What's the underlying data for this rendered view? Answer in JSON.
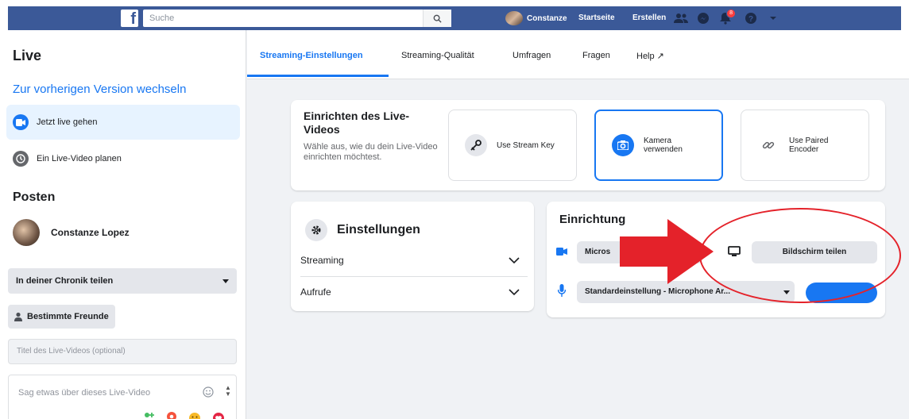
{
  "topbar": {
    "logo": "f",
    "search_placeholder": "Suche",
    "user_name": "Constanze",
    "home_label": "Startseite",
    "create_label": "Erstellen",
    "notifications_count": "8"
  },
  "sidebar": {
    "title": "Live",
    "switch_version": "Zur vorherigen Version wechseln",
    "items": [
      {
        "label": "Jetzt live gehen",
        "icon": "live-camera-icon"
      },
      {
        "label": "Ein Live-Video planen",
        "icon": "clock-icon"
      }
    ],
    "post_heading": "Posten",
    "profile_name": "Constanze Lopez",
    "share_dropdown": "In deiner Chronik teilen",
    "audience_button": "Bestimmte Freunde",
    "title_placeholder": "Titel des Live-Videos (optional)",
    "description_placeholder": "Sag etwas über dieses Live-Video"
  },
  "tabs": [
    {
      "label": "Streaming-Einstellungen",
      "active": true
    },
    {
      "label": "Streaming-Qualität"
    },
    {
      "label": "Umfragen"
    },
    {
      "label": "Fragen"
    },
    {
      "label": "Help ↗"
    }
  ],
  "setup": {
    "title": "Einrichten des Live-Videos",
    "subtitle": "Wähle aus, wie du dein Live-Video einrichten möchtest.",
    "options": [
      {
        "label": "Use Stream Key",
        "icon": "key-icon"
      },
      {
        "label": "Kamera verwenden",
        "icon": "camera-icon",
        "selected": true
      },
      {
        "label": "Use Paired Encoder",
        "icon": "link-icon"
      }
    ]
  },
  "settings": {
    "title": "Einstellungen",
    "rows": [
      "Streaming",
      "Aufrufe"
    ]
  },
  "einrichtung": {
    "title": "Einrichtung",
    "camera_select": "Micros",
    "share_screen_button": "Bildschirm teilen",
    "microphone_select": "Standardeinstellung - Microphone Ar..."
  },
  "colors": {
    "brand": "#3b5998",
    "accent": "#1877f2",
    "annotation": "#e4222a"
  }
}
